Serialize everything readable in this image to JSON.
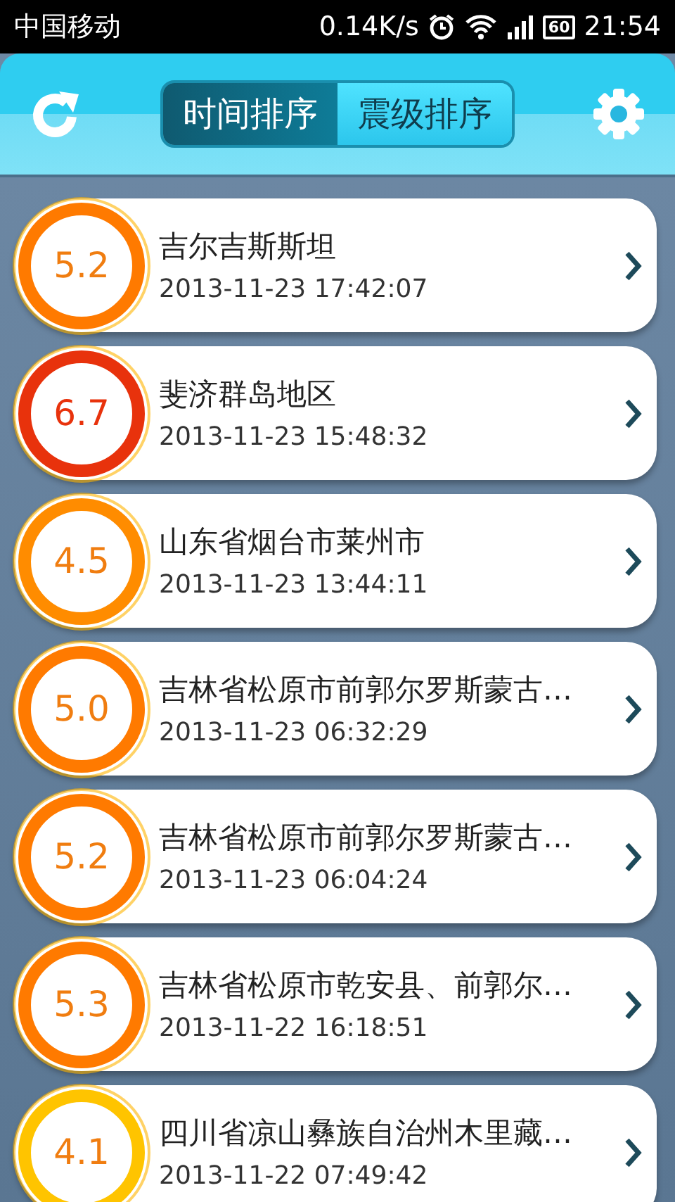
{
  "status_bar": {
    "carrier": "中国移动",
    "speed": "0.14K/s",
    "battery": "60",
    "time": "21:54"
  },
  "header": {
    "tabs": [
      {
        "label": "时间排序",
        "selected": true
      },
      {
        "label": "震级排序",
        "selected": false
      }
    ]
  },
  "quakes": [
    {
      "magnitude": "5.2",
      "color": "#ff7a00",
      "place": "吉尔吉斯斯坦",
      "time": "2013-11-23 17:42:07"
    },
    {
      "magnitude": "6.7",
      "color": "#e8320c",
      "place": "斐济群岛地区",
      "time": "2013-11-23 15:48:32"
    },
    {
      "magnitude": "4.5",
      "color": "#ff8c00",
      "place": "山东省烟台市莱州市",
      "time": "2013-11-23 13:44:11"
    },
    {
      "magnitude": "5.0",
      "color": "#ff7a00",
      "place": "吉林省松原市前郭尔罗斯蒙古…",
      "time": "2013-11-23 06:32:29"
    },
    {
      "magnitude": "5.2",
      "color": "#ff7a00",
      "place": "吉林省松原市前郭尔罗斯蒙古…",
      "time": "2013-11-23 06:04:24"
    },
    {
      "magnitude": "5.3",
      "color": "#ff7a00",
      "place": "吉林省松原市乾安县、前郭尔…",
      "time": "2013-11-22 16:18:51"
    },
    {
      "magnitude": "4.1",
      "color": "#ffc400",
      "place": "四川省凉山彝族自治州木里藏…",
      "time": "2013-11-22 07:49:42"
    }
  ]
}
